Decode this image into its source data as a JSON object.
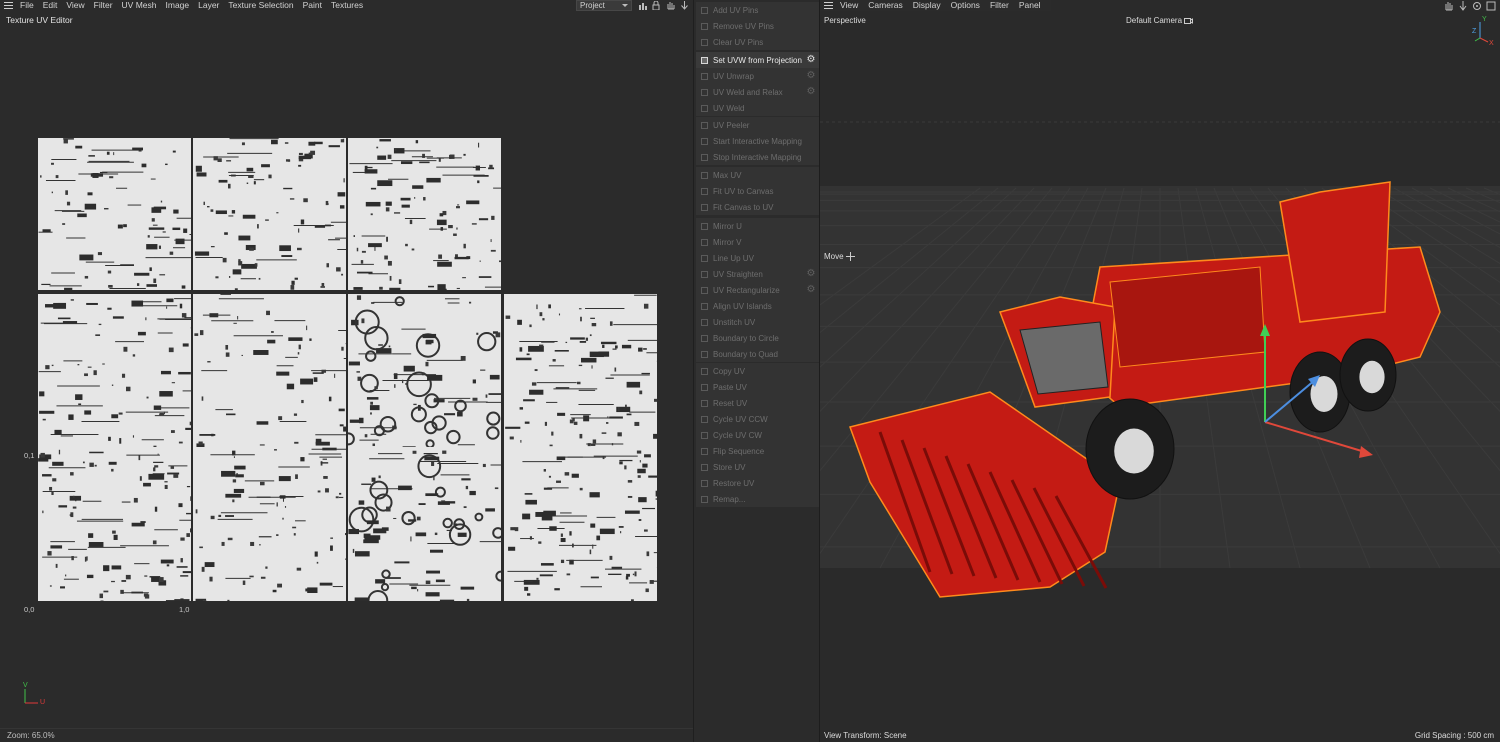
{
  "uv_editor": {
    "menu": [
      "File",
      "Edit",
      "View",
      "Filter",
      "UV Mesh",
      "Image",
      "Layer",
      "Texture Selection",
      "Paint",
      "Textures"
    ],
    "project_select": "Project",
    "title": "Texture UV Editor",
    "coords": {
      "origin": "0,0",
      "u_one": "1,0",
      "v_label": "0,1"
    },
    "axis": {
      "v": "V",
      "u": "U"
    },
    "zoom": "Zoom: 65.0%"
  },
  "uv_commands": {
    "groups": [
      [
        {
          "label": "Add UV Pins",
          "icon": "pin-icon",
          "enabled": false
        },
        {
          "label": "Remove UV Pins",
          "icon": "pin-remove-icon",
          "enabled": false
        },
        {
          "label": "Clear UV Pins",
          "icon": "clear-icon",
          "enabled": false
        }
      ],
      [
        {
          "label": "Set UVW from Projection",
          "icon": "projection-icon",
          "enabled": true,
          "gear": true
        },
        {
          "label": "UV Unwrap",
          "icon": "unwrap-icon",
          "enabled": false,
          "gear": true
        },
        {
          "label": "UV Weld and Relax",
          "icon": "weld-relax-icon",
          "enabled": false,
          "gear": true
        },
        {
          "label": "UV Weld",
          "icon": "weld-icon",
          "enabled": false
        }
      ],
      [
        {
          "label": "UV Peeler",
          "icon": "peeler-icon",
          "enabled": false
        },
        {
          "label": "Start Interactive Mapping",
          "icon": "play-icon",
          "enabled": false
        },
        {
          "label": "Stop Interactive Mapping",
          "icon": "stop-icon",
          "enabled": false
        }
      ],
      [
        {
          "label": "Max UV",
          "icon": "max-uv-icon",
          "enabled": false
        },
        {
          "label": "Fit UV to Canvas",
          "icon": "fit-uv-icon",
          "enabled": false
        },
        {
          "label": "Fit Canvas to UV",
          "icon": "fit-canvas-icon",
          "enabled": false
        }
      ],
      [
        {
          "label": "Mirror U",
          "icon": "mirror-u-icon",
          "enabled": false
        },
        {
          "label": "Mirror V",
          "icon": "mirror-v-icon",
          "enabled": false
        },
        {
          "label": "Line Up UV",
          "icon": "line-up-icon",
          "enabled": false
        },
        {
          "label": "UV Straighten",
          "icon": "straighten-icon",
          "enabled": false,
          "gear": true
        },
        {
          "label": "UV Rectangularize",
          "icon": "rectangularize-icon",
          "enabled": false,
          "gear": true
        },
        {
          "label": "Align UV Islands",
          "icon": "align-icon",
          "enabled": false
        },
        {
          "label": "Unstitch UV",
          "icon": "unstitch-icon",
          "enabled": false
        },
        {
          "label": "Boundary to Circle",
          "icon": "circle-icon",
          "enabled": false
        },
        {
          "label": "Boundary to Quad",
          "icon": "quad-icon",
          "enabled": false
        }
      ],
      [
        {
          "label": "Copy UV",
          "icon": "copy-icon",
          "enabled": false
        },
        {
          "label": "Paste UV",
          "icon": "paste-icon",
          "enabled": false
        },
        {
          "label": "Reset UV",
          "icon": "reset-icon",
          "enabled": false
        },
        {
          "label": "Cycle UV CCW",
          "icon": "cycle-ccw-icon",
          "enabled": false
        },
        {
          "label": "Cycle UV CW",
          "icon": "cycle-cw-icon",
          "enabled": false
        },
        {
          "label": "Flip Sequence",
          "icon": "flip-icon",
          "enabled": false
        },
        {
          "label": "Store UV",
          "icon": "store-icon",
          "enabled": false
        },
        {
          "label": "Restore UV",
          "icon": "restore-icon",
          "enabled": false
        },
        {
          "label": "Remap...",
          "icon": "remap-icon",
          "enabled": false
        }
      ]
    ]
  },
  "viewport": {
    "menu": [
      "View",
      "Cameras",
      "Display",
      "Options",
      "Filter",
      "Panel"
    ],
    "projection": "Perspective",
    "camera": "Default Camera",
    "tool": "Move",
    "view_transform": "View Transform: Scene",
    "grid_spacing": "Grid Spacing : 500 cm",
    "axis": {
      "y": "Y",
      "z": "Z",
      "x": "X"
    },
    "model_color": "#c41b14",
    "selection_color": "#ff8a1c"
  }
}
